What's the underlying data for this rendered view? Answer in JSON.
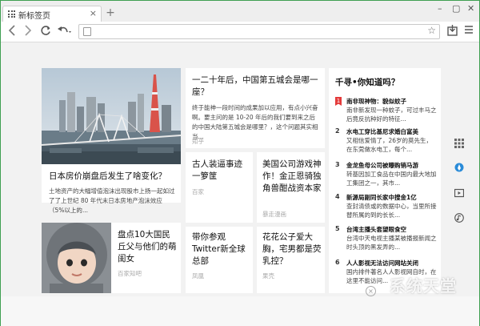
{
  "browser": {
    "tab_title": "新标签页",
    "tab_close": "×",
    "new_tab": "+",
    "window_controls": {
      "minimize": "–",
      "maximize": "▢",
      "close": "✕"
    },
    "address": {
      "value": "",
      "placeholder": ""
    }
  },
  "feed": {
    "card1": {
      "title": "日本房价崩盘后发生了啥变化？",
      "excerpt": "土地资产的大幅增值泡沫出现股市上扬一起如过了了上世纪 80 年代末日本房地产泡沫效应（5%以上的..."
    },
    "card2": {
      "title": "一二十年后，中国第五城会是哪一座？",
      "excerpt": "终于能神一段时间的成果加以应用，有点小兴奋啊。要主问的是 10-20 年后的我们要到来之后的中国大陆第五城会是哪里？，这个问题其实相当...",
      "source": "知乎"
    },
    "card3": {
      "title": "古人装逼事迹一箩筐",
      "source": "百家"
    },
    "card4": {
      "title": "美国公司游戏神作！金正恩骑独角兽酣战资本家",
      "source": "暴走漫画"
    },
    "card5": {
      "title": "盘点10大国民丘父与他们的萌闺女",
      "source": "百家知吧"
    },
    "card6": {
      "title": "带你参观Twitter新全球总部",
      "source": "凤凰"
    },
    "card7": {
      "title": "花花公子爱大胸，宅男都是荧乳控？",
      "source": "果壳"
    }
  },
  "sidebar": {
    "title": "千寻•你知道吗？",
    "items": [
      {
        "num": "1",
        "title": "南非现神物：貌似蚊子",
        "desc": "南非新发现一种蚊子，可过丰马之后竟反抗种好的特征..."
      },
      {
        "num": "2",
        "title": "水电工穿比基尼求婚白富美",
        "desc": "又相信爱情了，26岁的莫先生，在东莞做水电工，每个..."
      },
      {
        "num": "3",
        "title": "金龙鱼母公司被曝购销马游",
        "desc": "转基因加工食品在中国内最大地加工集团之一，其市..."
      },
      {
        "num": "4",
        "title": "新源局副同长家中搜金1亿",
        "desc": "查封清债或的数据中心，当里所接替所属的到的长长..."
      },
      {
        "num": "5",
        "title": "台湾主播头套望眼食空",
        "desc": "台湾中天电视主播某被播报新闻之时头顶的黑发弄的..."
      },
      {
        "num": "6",
        "title": "人人影视无法访问网站关闭",
        "desc": "国内排件著名人人影视网自时，在这里不能访问..."
      }
    ]
  },
  "watermark": "系统天堂"
}
